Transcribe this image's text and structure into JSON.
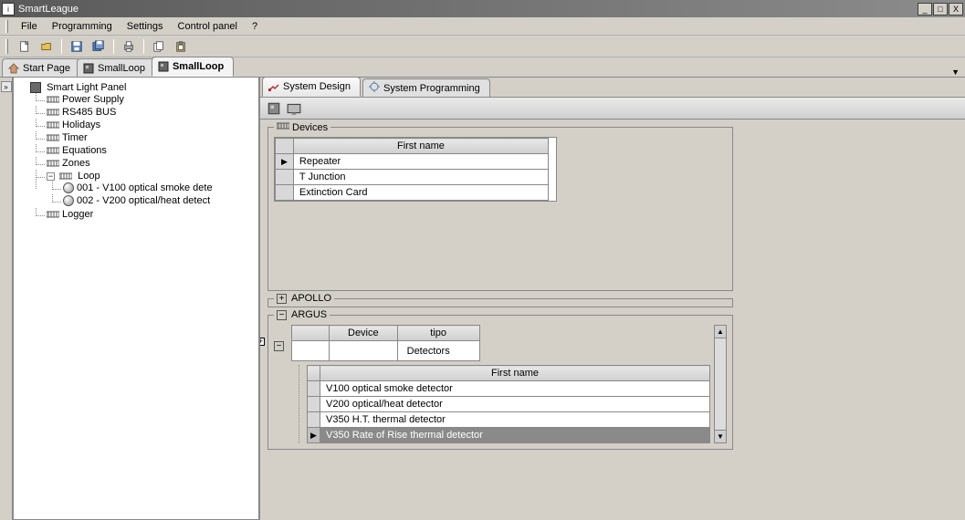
{
  "app_title": "SmartLeague",
  "menu": {
    "file": "File",
    "programming": "Programming",
    "settings": "Settings",
    "control_panel": "Control panel",
    "help": "?"
  },
  "doc_tabs": [
    {
      "label": "Start Page",
      "icon": "home-icon"
    },
    {
      "label": "SmallLoop",
      "icon": "panel-icon"
    },
    {
      "label": "SmallLoop",
      "icon": "panel-icon",
      "active": true
    }
  ],
  "tree": {
    "root": "Smart Light Panel",
    "children": [
      "Power Supply",
      "RS485 BUS",
      "Holidays",
      "Timer",
      "Equations",
      "Zones"
    ],
    "loop": {
      "label": "Loop",
      "items": [
        "001 - V100 optical smoke dete",
        "002 - V200 optical/heat detect"
      ]
    },
    "logger": "Logger"
  },
  "work_tabs": {
    "design": "System Design",
    "programming": "System Programming"
  },
  "groups": {
    "devices_label": "Devices",
    "apollo_label": "APOLLO",
    "argus_label": "ARGUS"
  },
  "devices_table": {
    "header": "First name",
    "rows": [
      "Repeater",
      "T Junction",
      "Extinction Card"
    ]
  },
  "argus_device_table": {
    "h1": "Device",
    "h2": "tipo",
    "row_tipo": "Detectors"
  },
  "argus_list": {
    "header": "First name",
    "rows": [
      "V100 optical smoke detector",
      "V200 optical/heat detector",
      "V350 H.T. thermal detector",
      "V350 Rate of Rise thermal detector"
    ],
    "selected_index": 3
  }
}
